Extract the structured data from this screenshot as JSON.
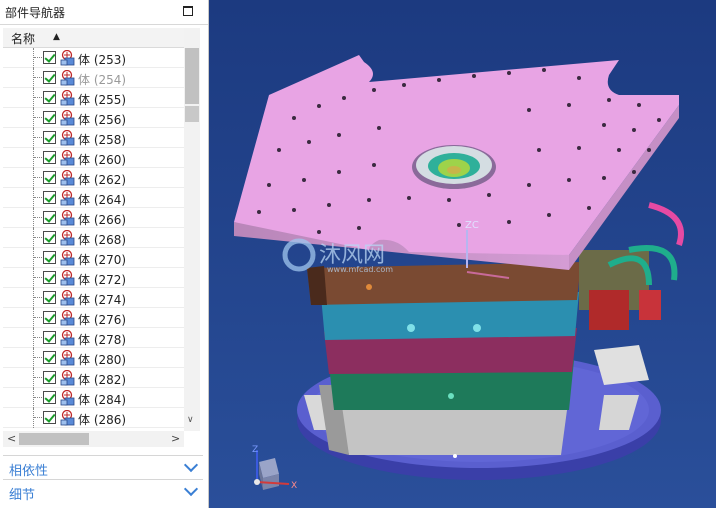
{
  "navigator": {
    "title": "部件导航器",
    "column_name": "名称",
    "rows": [
      {
        "label": "体 (253)",
        "dim": false
      },
      {
        "label": "体 (254)",
        "dim": true
      },
      {
        "label": "体 (255)",
        "dim": false
      },
      {
        "label": "体 (256)",
        "dim": false
      },
      {
        "label": "体 (258)",
        "dim": false
      },
      {
        "label": "体 (260)",
        "dim": false
      },
      {
        "label": "体 (262)",
        "dim": false
      },
      {
        "label": "体 (264)",
        "dim": false
      },
      {
        "label": "体 (266)",
        "dim": false
      },
      {
        "label": "体 (268)",
        "dim": false
      },
      {
        "label": "体 (270)",
        "dim": false
      },
      {
        "label": "体 (272)",
        "dim": false
      },
      {
        "label": "体 (274)",
        "dim": false
      },
      {
        "label": "体 (276)",
        "dim": false
      },
      {
        "label": "体 (278)",
        "dim": false
      },
      {
        "label": "体 (280)",
        "dim": false
      },
      {
        "label": "体 (282)",
        "dim": false
      },
      {
        "label": "体 (284)",
        "dim": false
      },
      {
        "label": "体 (286)",
        "dim": false
      }
    ]
  },
  "sections": {
    "dependencies": "相依性",
    "details": "细节"
  },
  "viewport": {
    "watermark_text": "沐风网",
    "watermark_url": "www.mfcad.com",
    "wcs_label": "ZC",
    "triad_x": "X",
    "triad_z": "Z"
  },
  "colors": {
    "background": "#1f3f86",
    "top_plate": "#e8a4e4",
    "accent": "#3a7fd4"
  }
}
